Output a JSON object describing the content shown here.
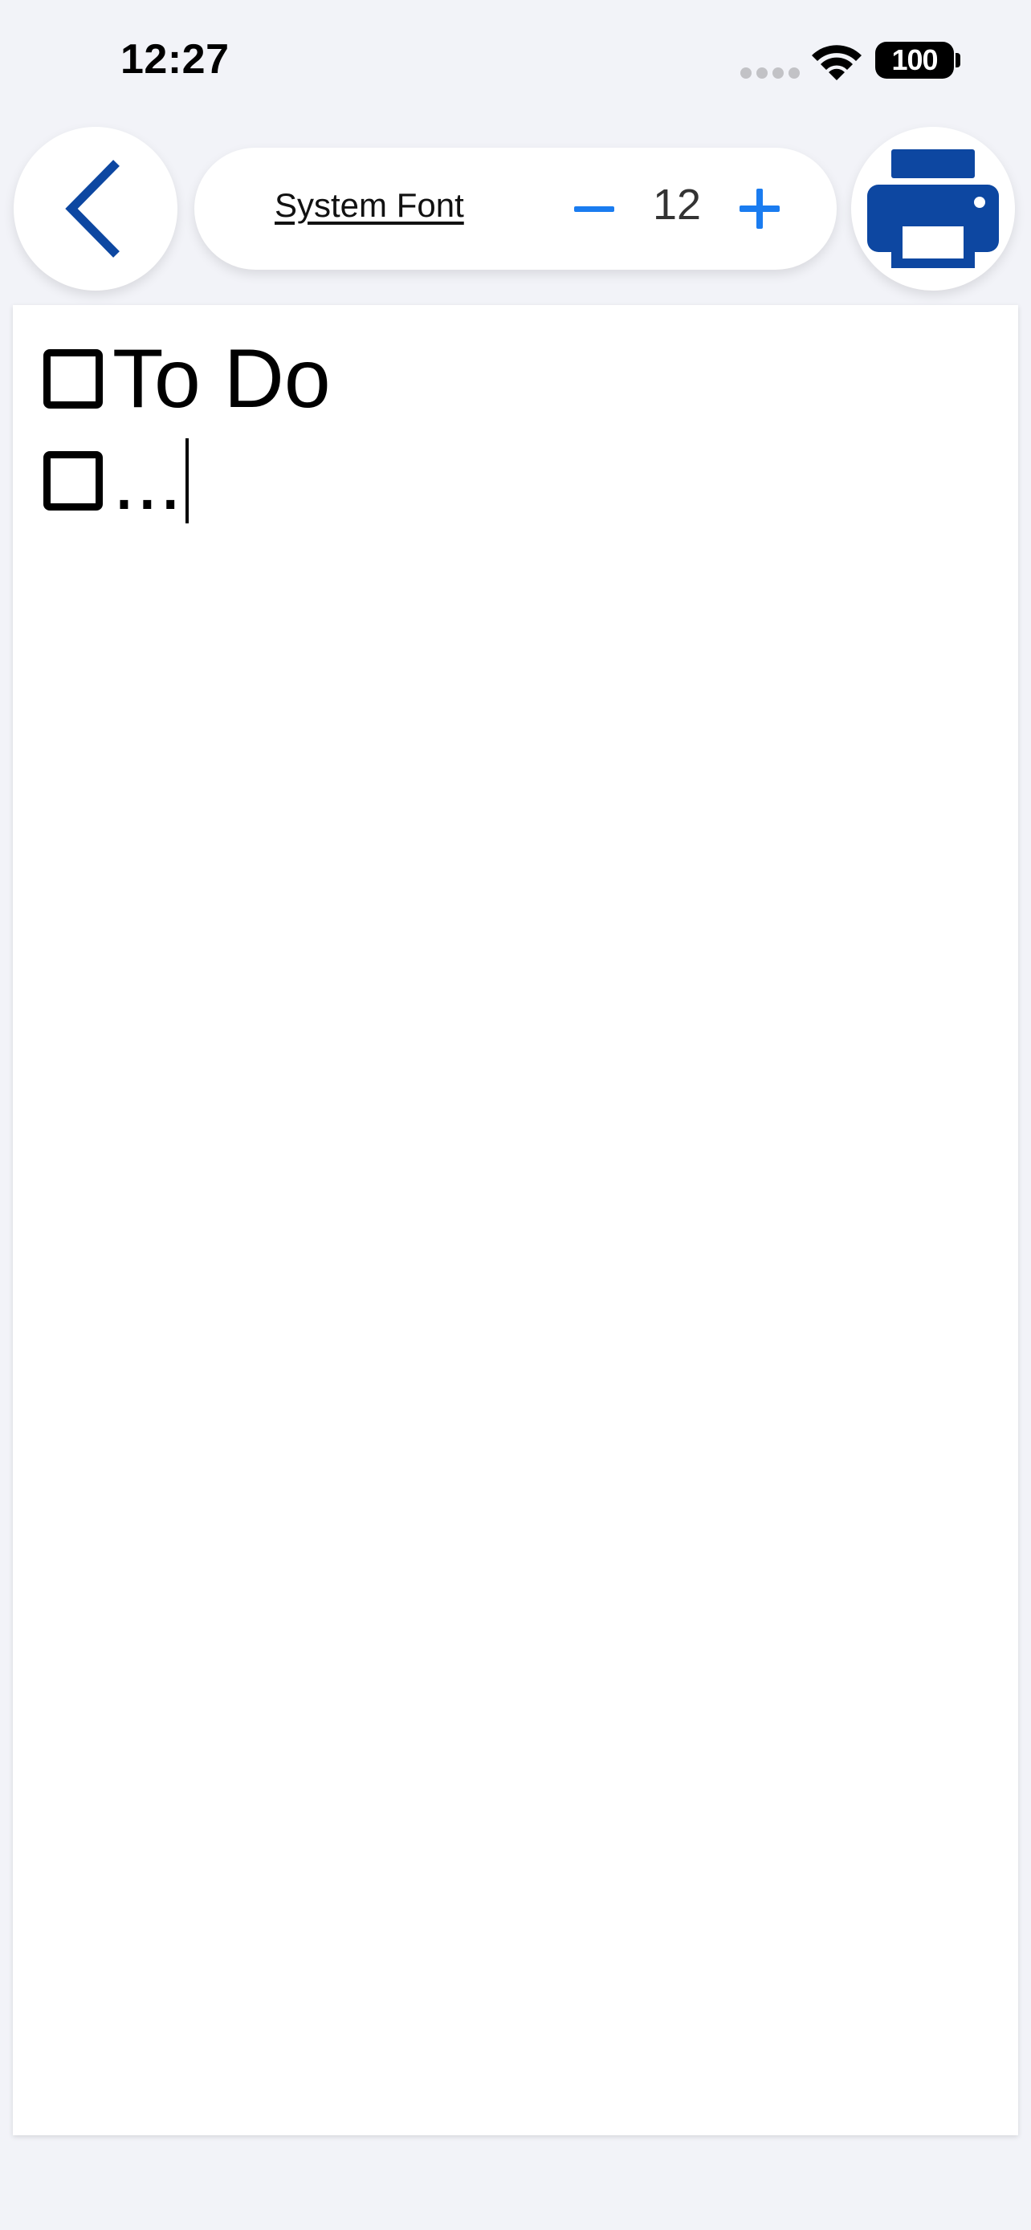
{
  "status_bar": {
    "time": "12:27",
    "battery": "100"
  },
  "toolbar": {
    "back_icon": "chevron-left-icon",
    "font_name": "System Font",
    "font_size": "12",
    "decrease_icon": "minus-icon",
    "increase_icon": "plus-icon",
    "print_icon": "printer-icon"
  },
  "colors": {
    "accent_blue": "#1a7cf0",
    "brand_blue": "#0d47a1",
    "background": "#f2f3f8"
  },
  "editor": {
    "lines": [
      {
        "checked": false,
        "text": "To Do"
      },
      {
        "checked": false,
        "text": "..."
      }
    ]
  }
}
